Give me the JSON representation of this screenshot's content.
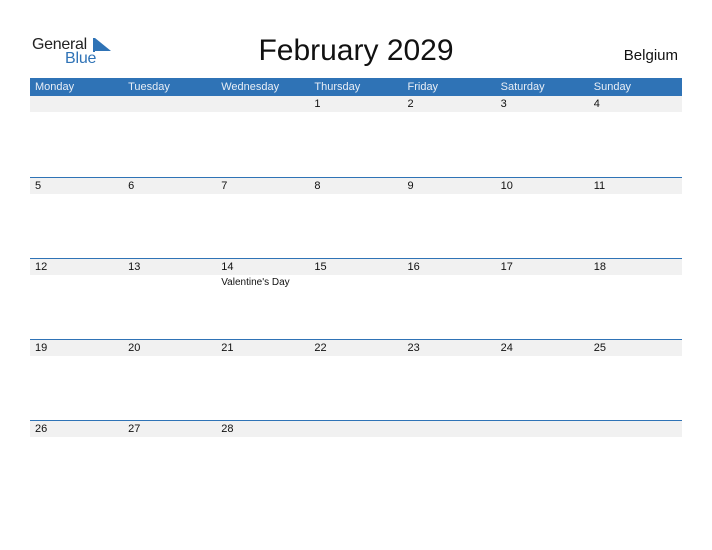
{
  "logo": {
    "line1": "General",
    "line2": "Blue",
    "icon": "triangle-flag-icon",
    "brand_color": "#2f73b6"
  },
  "title": "February 2029",
  "country": "Belgium",
  "header_color": "#2f73b6",
  "weekdays": [
    "Monday",
    "Tuesday",
    "Wednesday",
    "Thursday",
    "Friday",
    "Saturday",
    "Sunday"
  ],
  "weeks": [
    {
      "days": [
        "",
        "",
        "",
        "1",
        "2",
        "3",
        "4"
      ],
      "events": [
        "",
        "",
        "",
        "",
        "",
        "",
        ""
      ]
    },
    {
      "days": [
        "5",
        "6",
        "7",
        "8",
        "9",
        "10",
        "11"
      ],
      "events": [
        "",
        "",
        "",
        "",
        "",
        "",
        ""
      ]
    },
    {
      "days": [
        "12",
        "13",
        "14",
        "15",
        "16",
        "17",
        "18"
      ],
      "events": [
        "",
        "",
        "Valentine's Day",
        "",
        "",
        "",
        ""
      ]
    },
    {
      "days": [
        "19",
        "20",
        "21",
        "22",
        "23",
        "24",
        "25"
      ],
      "events": [
        "",
        "",
        "",
        "",
        "",
        "",
        ""
      ]
    },
    {
      "days": [
        "26",
        "27",
        "28",
        "",
        "",
        "",
        ""
      ],
      "events": [
        "",
        "",
        "",
        "",
        "",
        "",
        ""
      ]
    }
  ]
}
